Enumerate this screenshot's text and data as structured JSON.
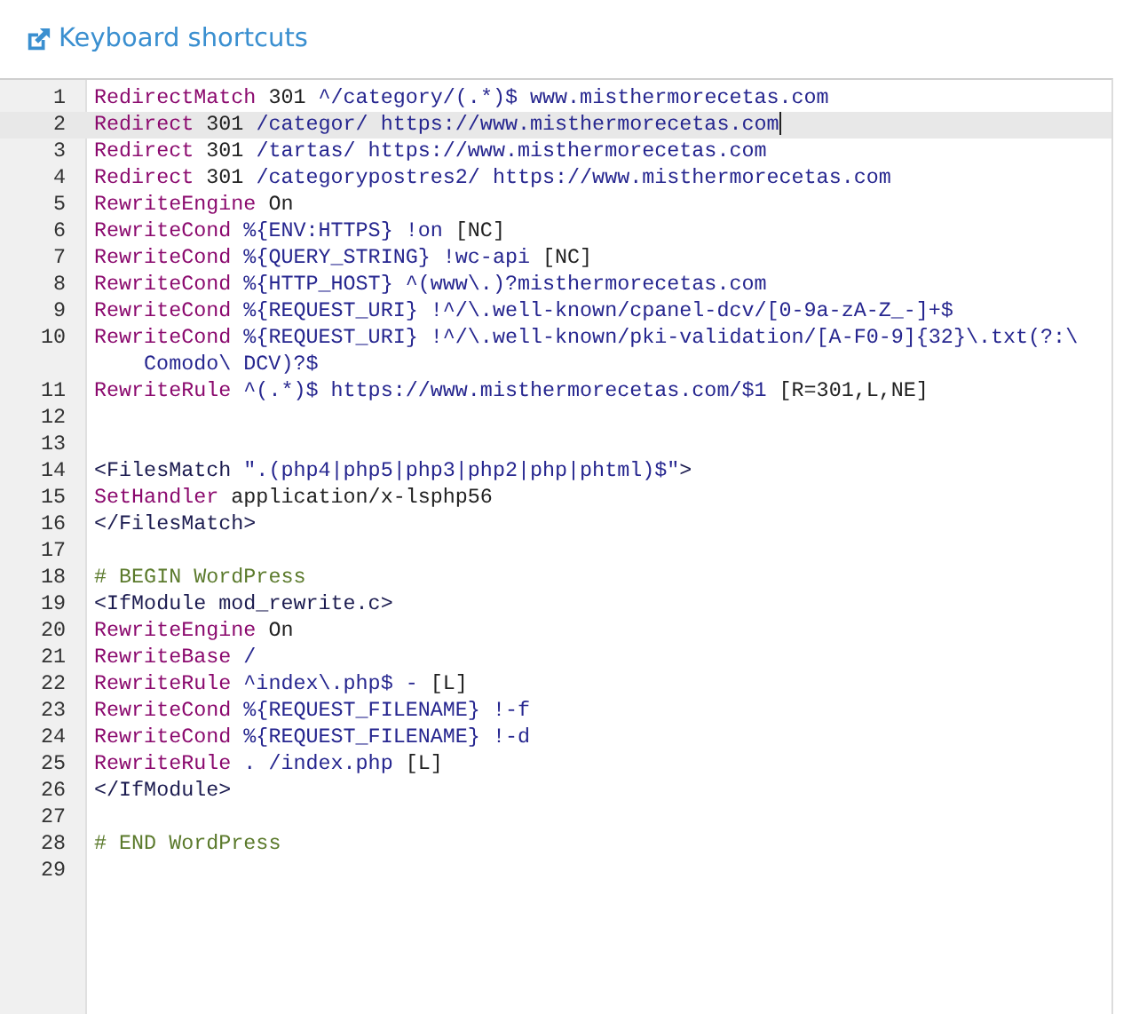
{
  "header": {
    "link": "Keyboard shortcuts"
  },
  "editor": {
    "lines": [
      {
        "number": "1",
        "selected": false,
        "tokens": [
          {
            "kind": "keyword",
            "text": "RedirectMatch"
          },
          {
            "kind": "plain",
            "text": " 301 "
          },
          {
            "kind": "string",
            "text": "^/category/(.*)$ www.misthermorecetas.com"
          }
        ]
      },
      {
        "number": "2",
        "selected": true,
        "tokens": [
          {
            "kind": "keyword",
            "text": "Redirect"
          },
          {
            "kind": "plain",
            "text": " 301 "
          },
          {
            "kind": "string",
            "text": "/categor/ https://www.misthermorecetas.com"
          }
        ]
      },
      {
        "number": "3",
        "selected": false,
        "tokens": [
          {
            "kind": "keyword",
            "text": "Redirect"
          },
          {
            "kind": "plain",
            "text": " 301 "
          },
          {
            "kind": "string",
            "text": "/tartas/ https://www.misthermorecetas.com"
          }
        ]
      },
      {
        "number": "4",
        "selected": false,
        "tokens": [
          {
            "kind": "keyword",
            "text": "Redirect"
          },
          {
            "kind": "plain",
            "text": " 301 "
          },
          {
            "kind": "string",
            "text": "/categorypostres2/ https://www.misthermorecetas.com"
          }
        ]
      },
      {
        "number": "5",
        "selected": false,
        "tokens": [
          {
            "kind": "keyword",
            "text": "RewriteEngine"
          },
          {
            "kind": "plain",
            "text": " On"
          }
        ]
      },
      {
        "number": "6",
        "selected": false,
        "tokens": [
          {
            "kind": "keyword",
            "text": "RewriteCond"
          },
          {
            "kind": "string",
            "text": " %{ENV:HTTPS} !on "
          },
          {
            "kind": "plain",
            "text": "[NC]"
          }
        ]
      },
      {
        "number": "7",
        "selected": false,
        "tokens": [
          {
            "kind": "keyword",
            "text": "RewriteCond"
          },
          {
            "kind": "string",
            "text": " %{QUERY_STRING} !wc-api "
          },
          {
            "kind": "plain",
            "text": "[NC]"
          }
        ]
      },
      {
        "number": "8",
        "selected": false,
        "tokens": [
          {
            "kind": "keyword",
            "text": "RewriteCond"
          },
          {
            "kind": "string",
            "text": " %{HTTP_HOST} ^(www\\.)?misthermorecetas.com"
          }
        ]
      },
      {
        "number": "9",
        "selected": false,
        "tokens": [
          {
            "kind": "keyword",
            "text": "RewriteCond"
          },
          {
            "kind": "string",
            "text": " %{REQUEST_URI} !^/\\.well-known/cpanel-dcv/[0-9a-zA-Z_-]+$"
          }
        ]
      },
      {
        "number": "10",
        "selected": false,
        "tokens": [
          {
            "kind": "keyword",
            "text": "RewriteCond"
          },
          {
            "kind": "string",
            "text": " %{REQUEST_URI} !^/\\.well-known/pki-validation/[A-F0-9]{32}\\.txt(?:\\ Comodo\\ DCV)?$"
          }
        ]
      },
      {
        "number": "11",
        "selected": false,
        "tokens": [
          {
            "kind": "keyword",
            "text": "RewriteRule"
          },
          {
            "kind": "string",
            "text": " ^(.*)$ https://www.misthermorecetas.com/$1 "
          },
          {
            "kind": "plain",
            "text": "[R=301,L,NE]"
          }
        ]
      },
      {
        "number": "12",
        "selected": false
      },
      {
        "number": "13",
        "selected": false
      },
      {
        "number": "14",
        "selected": false,
        "tokens": [
          {
            "kind": "tag",
            "text": "<FilesMatch "
          },
          {
            "kind": "string",
            "text": "\".(php4|php5|php3|php2|php|phtml)$\""
          },
          {
            "kind": "tag",
            "text": ">"
          }
        ]
      },
      {
        "number": "15",
        "selected": false,
        "tokens": [
          {
            "kind": "keyword",
            "text": "SetHandler"
          },
          {
            "kind": "plain",
            "text": " application/x-lsphp56"
          }
        ]
      },
      {
        "number": "16",
        "selected": false,
        "tokens": [
          {
            "kind": "tag",
            "text": "</FilesMatch>"
          }
        ]
      },
      {
        "number": "17",
        "selected": false
      },
      {
        "number": "18",
        "selected": false,
        "tokens": [
          {
            "kind": "comment",
            "text": "# BEGIN WordPress"
          }
        ]
      },
      {
        "number": "19",
        "selected": false,
        "tokens": [
          {
            "kind": "tag",
            "text": "<IfModule mod_rewrite.c>"
          }
        ]
      },
      {
        "number": "20",
        "selected": false,
        "tokens": [
          {
            "kind": "keyword",
            "text": "RewriteEngine"
          },
          {
            "kind": "plain",
            "text": " On"
          }
        ]
      },
      {
        "number": "21",
        "selected": false,
        "tokens": [
          {
            "kind": "keyword",
            "text": "RewriteBase"
          },
          {
            "kind": "string",
            "text": " /"
          }
        ]
      },
      {
        "number": "22",
        "selected": false,
        "tokens": [
          {
            "kind": "keyword",
            "text": "RewriteRule"
          },
          {
            "kind": "string",
            "text": " ^index\\.php$ - "
          },
          {
            "kind": "plain",
            "text": "[L]"
          }
        ]
      },
      {
        "number": "23",
        "selected": false,
        "tokens": [
          {
            "kind": "keyword",
            "text": "RewriteCond"
          },
          {
            "kind": "string",
            "text": " %{REQUEST_FILENAME} !-f"
          }
        ]
      },
      {
        "number": "24",
        "selected": false,
        "tokens": [
          {
            "kind": "keyword",
            "text": "RewriteCond"
          },
          {
            "kind": "string",
            "text": " %{REQUEST_FILENAME} !-d"
          }
        ]
      },
      {
        "number": "25",
        "selected": false,
        "tokens": [
          {
            "kind": "keyword",
            "text": "RewriteRule"
          },
          {
            "kind": "string",
            "text": " . /index.php "
          },
          {
            "kind": "plain",
            "text": "[L]"
          }
        ]
      },
      {
        "number": "26",
        "selected": false,
        "tokens": [
          {
            "kind": "tag",
            "text": "</IfModule>"
          }
        ]
      },
      {
        "number": "27",
        "selected": false
      },
      {
        "number": "28",
        "selected": false,
        "tokens": [
          {
            "kind": "comment",
            "text": "# END WordPress"
          }
        ]
      },
      {
        "number": "29",
        "selected": false
      }
    ]
  }
}
